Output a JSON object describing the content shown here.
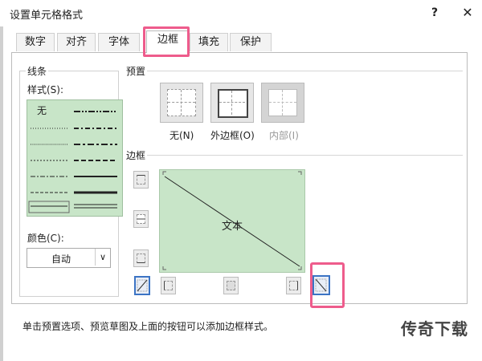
{
  "window": {
    "title": "设置单元格格式",
    "help": "?",
    "close": "✕"
  },
  "tabs": [
    {
      "label": "数字"
    },
    {
      "label": "对齐"
    },
    {
      "label": "字体"
    },
    {
      "label": "边框",
      "active": true
    },
    {
      "label": "填充"
    },
    {
      "label": "保护"
    }
  ],
  "line": {
    "group_label": "线条",
    "style_label": "样式(S):",
    "none_label": "无",
    "color_label": "颜色(C):",
    "color_value": "自动"
  },
  "presets": {
    "label": "预置",
    "items": [
      {
        "label": "无(N)"
      },
      {
        "label": "外边框(O)"
      },
      {
        "label": "内部(I)",
        "disabled": true
      }
    ]
  },
  "border": {
    "label": "边框",
    "preview_text": "文本",
    "selected": [
      "diagonal-up",
      "diagonal-down"
    ]
  },
  "hint": "单击预置选项、预览草图及上面的按钮可以添加边框样式。",
  "watermark": "传奇下载",
  "colors": {
    "accent_highlight": "#ee5c8c",
    "preview_bg": "#c8e5c8",
    "select_blue": "#3c74c4"
  }
}
